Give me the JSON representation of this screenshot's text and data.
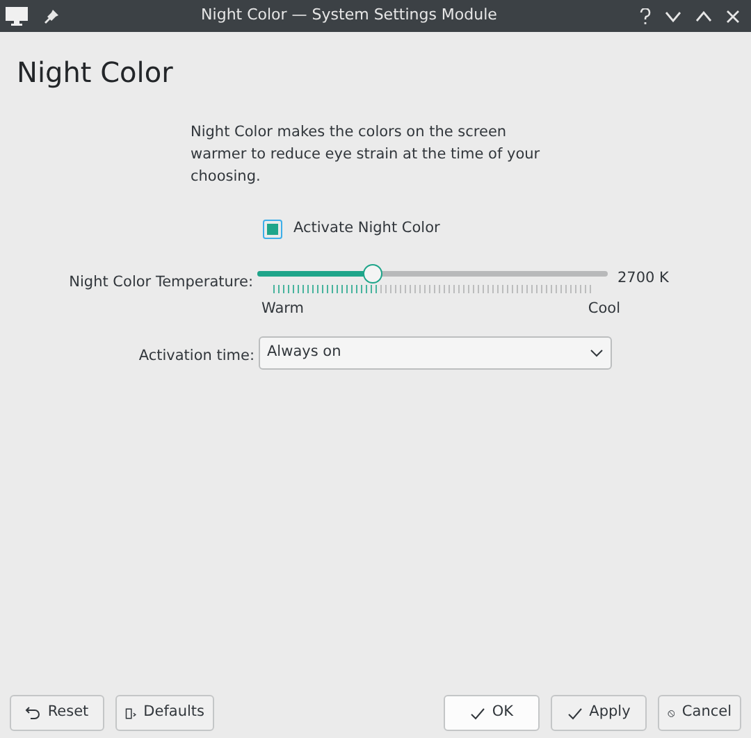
{
  "window": {
    "title": "Night Color — System Settings Module"
  },
  "heading": "Night Color",
  "description": "Night Color makes the colors on the screen warmer to reduce eye strain at the time of your choosing.",
  "activate": {
    "label": "Activate Night Color",
    "checked": true
  },
  "temperature": {
    "label": "Night Color Temperature:",
    "level": 0.32,
    "reading": "2700 K",
    "min_label": "Warm",
    "max_label": "Cool"
  },
  "activation_time": {
    "label": "Activation time:",
    "value": "Always on"
  },
  "buttons": [
    {
      "label": "Reset",
      "kind": "reset"
    },
    {
      "label": "Defaults",
      "kind": "defaults"
    },
    {
      "label": "OK",
      "kind": "ok"
    },
    {
      "label": "Apply",
      "kind": "apply"
    },
    {
      "label": "Cancel",
      "kind": "cancel"
    }
  ]
}
